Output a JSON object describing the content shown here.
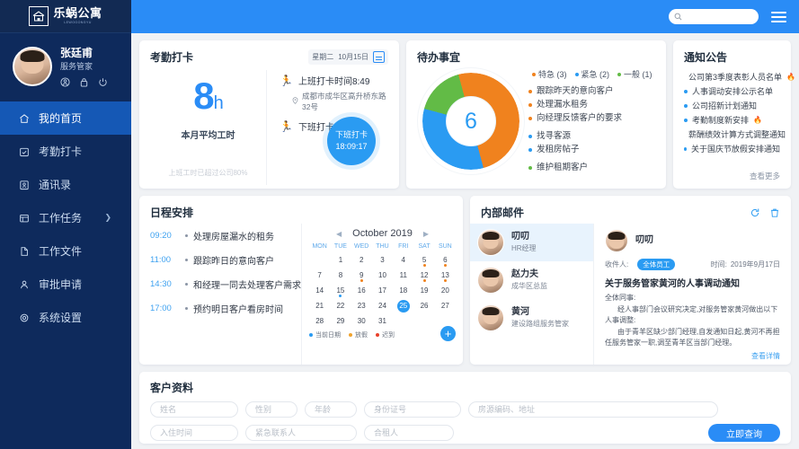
{
  "brand": {
    "cn": "乐蜗公寓",
    "en": "LEWOGONGYU",
    "logo_icon": "house-icon"
  },
  "topbar": {
    "search_placeholder": "",
    "search_value": "",
    "search_icon": "search-icon",
    "menu_icon": "hamburger-icon"
  },
  "profile": {
    "name": "张廷甫",
    "role": "服务管家",
    "icons": [
      "user-circle-icon",
      "lock-icon",
      "power-icon"
    ]
  },
  "sidebar": {
    "items": [
      {
        "label": "我的首页",
        "icon": "home-icon",
        "active": true,
        "chevron": false
      },
      {
        "label": "考勤打卡",
        "icon": "attendance-icon",
        "active": false,
        "chevron": false
      },
      {
        "label": "通讯录",
        "icon": "contacts-icon",
        "active": false,
        "chevron": false
      },
      {
        "label": "工作任务",
        "icon": "task-icon",
        "active": false,
        "chevron": true
      },
      {
        "label": "工作文件",
        "icon": "file-icon",
        "active": false,
        "chevron": false
      },
      {
        "label": "审批申请",
        "icon": "approval-icon",
        "active": false,
        "chevron": false
      },
      {
        "label": "系统设置",
        "icon": "gear-icon",
        "active": false,
        "chevron": false
      }
    ]
  },
  "attendance": {
    "title": "考勤打卡",
    "weekday": "星期二",
    "date": "10月15日",
    "calendar_icon": "calendar-icon",
    "hours_value": "8",
    "hours_unit": "h",
    "avg_label": "本月平均工时",
    "over_label": "上班工时已超过公司80%",
    "checkin_text": "上班打卡时间8:49",
    "location": "成都市成华区高升桥东路32号",
    "location_icon": "location-pin-icon",
    "checkout_text": "下班打卡",
    "punch_label": "下班打卡",
    "punch_time": "18:09:17",
    "run_icon": "running-icon"
  },
  "todo": {
    "title": "待办事宜",
    "center_count": "6",
    "legend": [
      {
        "label": "特急 (3)",
        "color": "#f0821e"
      },
      {
        "label": "紧急 (2)",
        "color": "#2a9bf2"
      },
      {
        "label": "一般 (1)",
        "color": "#62bb46"
      }
    ],
    "groups": [
      {
        "color": "#f0821e",
        "items": [
          "跟踪昨天的意向客户",
          "处理漏水租务",
          "向经理反馈客户的要求"
        ]
      },
      {
        "color": "#2a9bf2",
        "items": [
          "找寻客源",
          "发租房帖子"
        ]
      },
      {
        "color": "#62bb46",
        "items": [
          "维护租期客户"
        ]
      }
    ]
  },
  "notice": {
    "title": "通知公告",
    "more_label": "查看更多",
    "items": [
      {
        "text": "公司第3季度表彰人员名单",
        "hot": true
      },
      {
        "text": "人事调动安排公示名单",
        "hot": false
      },
      {
        "text": "公司招新计划通知",
        "hot": false
      },
      {
        "text": "考勤制度新安排",
        "hot": true
      },
      {
        "text": "薪酬绩效计算方式调整通知",
        "hot": false
      },
      {
        "text": "关于国庆节放假安排通知",
        "hot": false
      }
    ]
  },
  "schedule": {
    "title": "日程安排",
    "items": [
      {
        "time": "09:20",
        "text": "处理房屋漏水的租务"
      },
      {
        "time": "11:00",
        "text": "跟踪昨日的意向客户"
      },
      {
        "time": "14:30",
        "text": "和经理一同去处理客户需求"
      },
      {
        "time": "17:00",
        "text": "预约明日客户看房时间"
      }
    ]
  },
  "calendar": {
    "month_label": "October 2019",
    "prev_icon": "chevron-left-icon",
    "next_icon": "chevron-right-icon",
    "dow": [
      "MON",
      "TUE",
      "WED",
      "THU",
      "FRI",
      "SAT",
      "SUN"
    ],
    "blanks": 1,
    "days": [
      {
        "d": "1"
      },
      {
        "d": "2"
      },
      {
        "d": "3"
      },
      {
        "d": "4"
      },
      {
        "d": "5",
        "mark": "#f0821e"
      },
      {
        "d": "6",
        "mark": "#f0821e"
      },
      {
        "d": "7"
      },
      {
        "d": "8"
      },
      {
        "d": "9",
        "mark": "#f0821e"
      },
      {
        "d": "10"
      },
      {
        "d": "11"
      },
      {
        "d": "12",
        "mark": "#f0821e"
      },
      {
        "d": "13",
        "mark": "#f0821e"
      },
      {
        "d": "14"
      },
      {
        "d": "15",
        "mark": "#2a9bf2"
      },
      {
        "d": "16"
      },
      {
        "d": "17"
      },
      {
        "d": "18"
      },
      {
        "d": "19"
      },
      {
        "d": "20"
      },
      {
        "d": "21"
      },
      {
        "d": "22"
      },
      {
        "d": "23"
      },
      {
        "d": "24"
      },
      {
        "d": "25",
        "today": true
      },
      {
        "d": "26"
      },
      {
        "d": "27"
      },
      {
        "d": "28"
      },
      {
        "d": "29"
      },
      {
        "d": "30"
      },
      {
        "d": "31"
      }
    ],
    "legend": [
      {
        "label": "当前日期",
        "color": "#2a9bf2"
      },
      {
        "label": "放假",
        "color": "#f0a32e"
      },
      {
        "label": "迟到",
        "color": "#e8402a"
      }
    ],
    "add_label": "+"
  },
  "mail": {
    "title": "内部邮件",
    "actions": [
      {
        "icon": "refresh-icon"
      },
      {
        "icon": "trash-icon"
      }
    ],
    "people": [
      {
        "name": "叨叨",
        "role": "HR经理",
        "selected": true
      },
      {
        "name": "赵力夫",
        "role": "成华区总监",
        "selected": false
      },
      {
        "name": "黄河",
        "role": "建设路组服务管家",
        "selected": false
      }
    ],
    "detail": {
      "from": "叨叨",
      "to_label": "收件人:",
      "to_tag": "全体员工",
      "time_label": "时间:",
      "time_value": "2019年9月17日",
      "subject": "关于服务管家黄河的人事调动通知",
      "body": [
        "全体同事:",
        "经人事部门会议研究决定,对服务管家黄河做出以下人事调整:",
        "由于青羊区缺少部门经理,自发通知日起,黄河不再担任服务管家一职,调至青羊区当部门经理。"
      ],
      "detail_link": "查看详情"
    }
  },
  "customer": {
    "title": "客户资料",
    "fields_row1": [
      {
        "placeholder": "姓名",
        "name": "name-field",
        "w": "w-name"
      },
      {
        "placeholder": "性别",
        "name": "gender-field",
        "w": "w-sex"
      },
      {
        "placeholder": "年龄",
        "name": "age-field",
        "w": "w-age"
      },
      {
        "placeholder": "身份证号",
        "name": "id-number-field",
        "w": "w-id"
      },
      {
        "placeholder": "房源编码、地址",
        "name": "property-address-field",
        "w": "w-addr"
      }
    ],
    "fields_row2": [
      {
        "placeholder": "入住时间",
        "name": "checkin-date-field",
        "w": "w-in"
      },
      {
        "placeholder": "紧急联系人",
        "name": "emergency-contact-field",
        "w": "w-emg"
      },
      {
        "placeholder": "合租人",
        "name": "roommate-field",
        "w": "w-co"
      }
    ],
    "query_label": "立即查询"
  },
  "colors": {
    "brand_blue": "#2a8cf6",
    "sidebar_navy": "#0e2a5c",
    "active_blue": "#1558b5",
    "orange": "#f0821e",
    "green": "#62bb46",
    "light_blue": "#2a9bf2"
  },
  "chart_data": {
    "type": "pie",
    "title": "待办事宜",
    "categories": [
      "特急",
      "紧急",
      "一般"
    ],
    "values": [
      3,
      2,
      1
    ],
    "colors": [
      "#f0821e",
      "#2a9bf2",
      "#62bb46"
    ],
    "total": 6,
    "legend_position": "top-right"
  }
}
